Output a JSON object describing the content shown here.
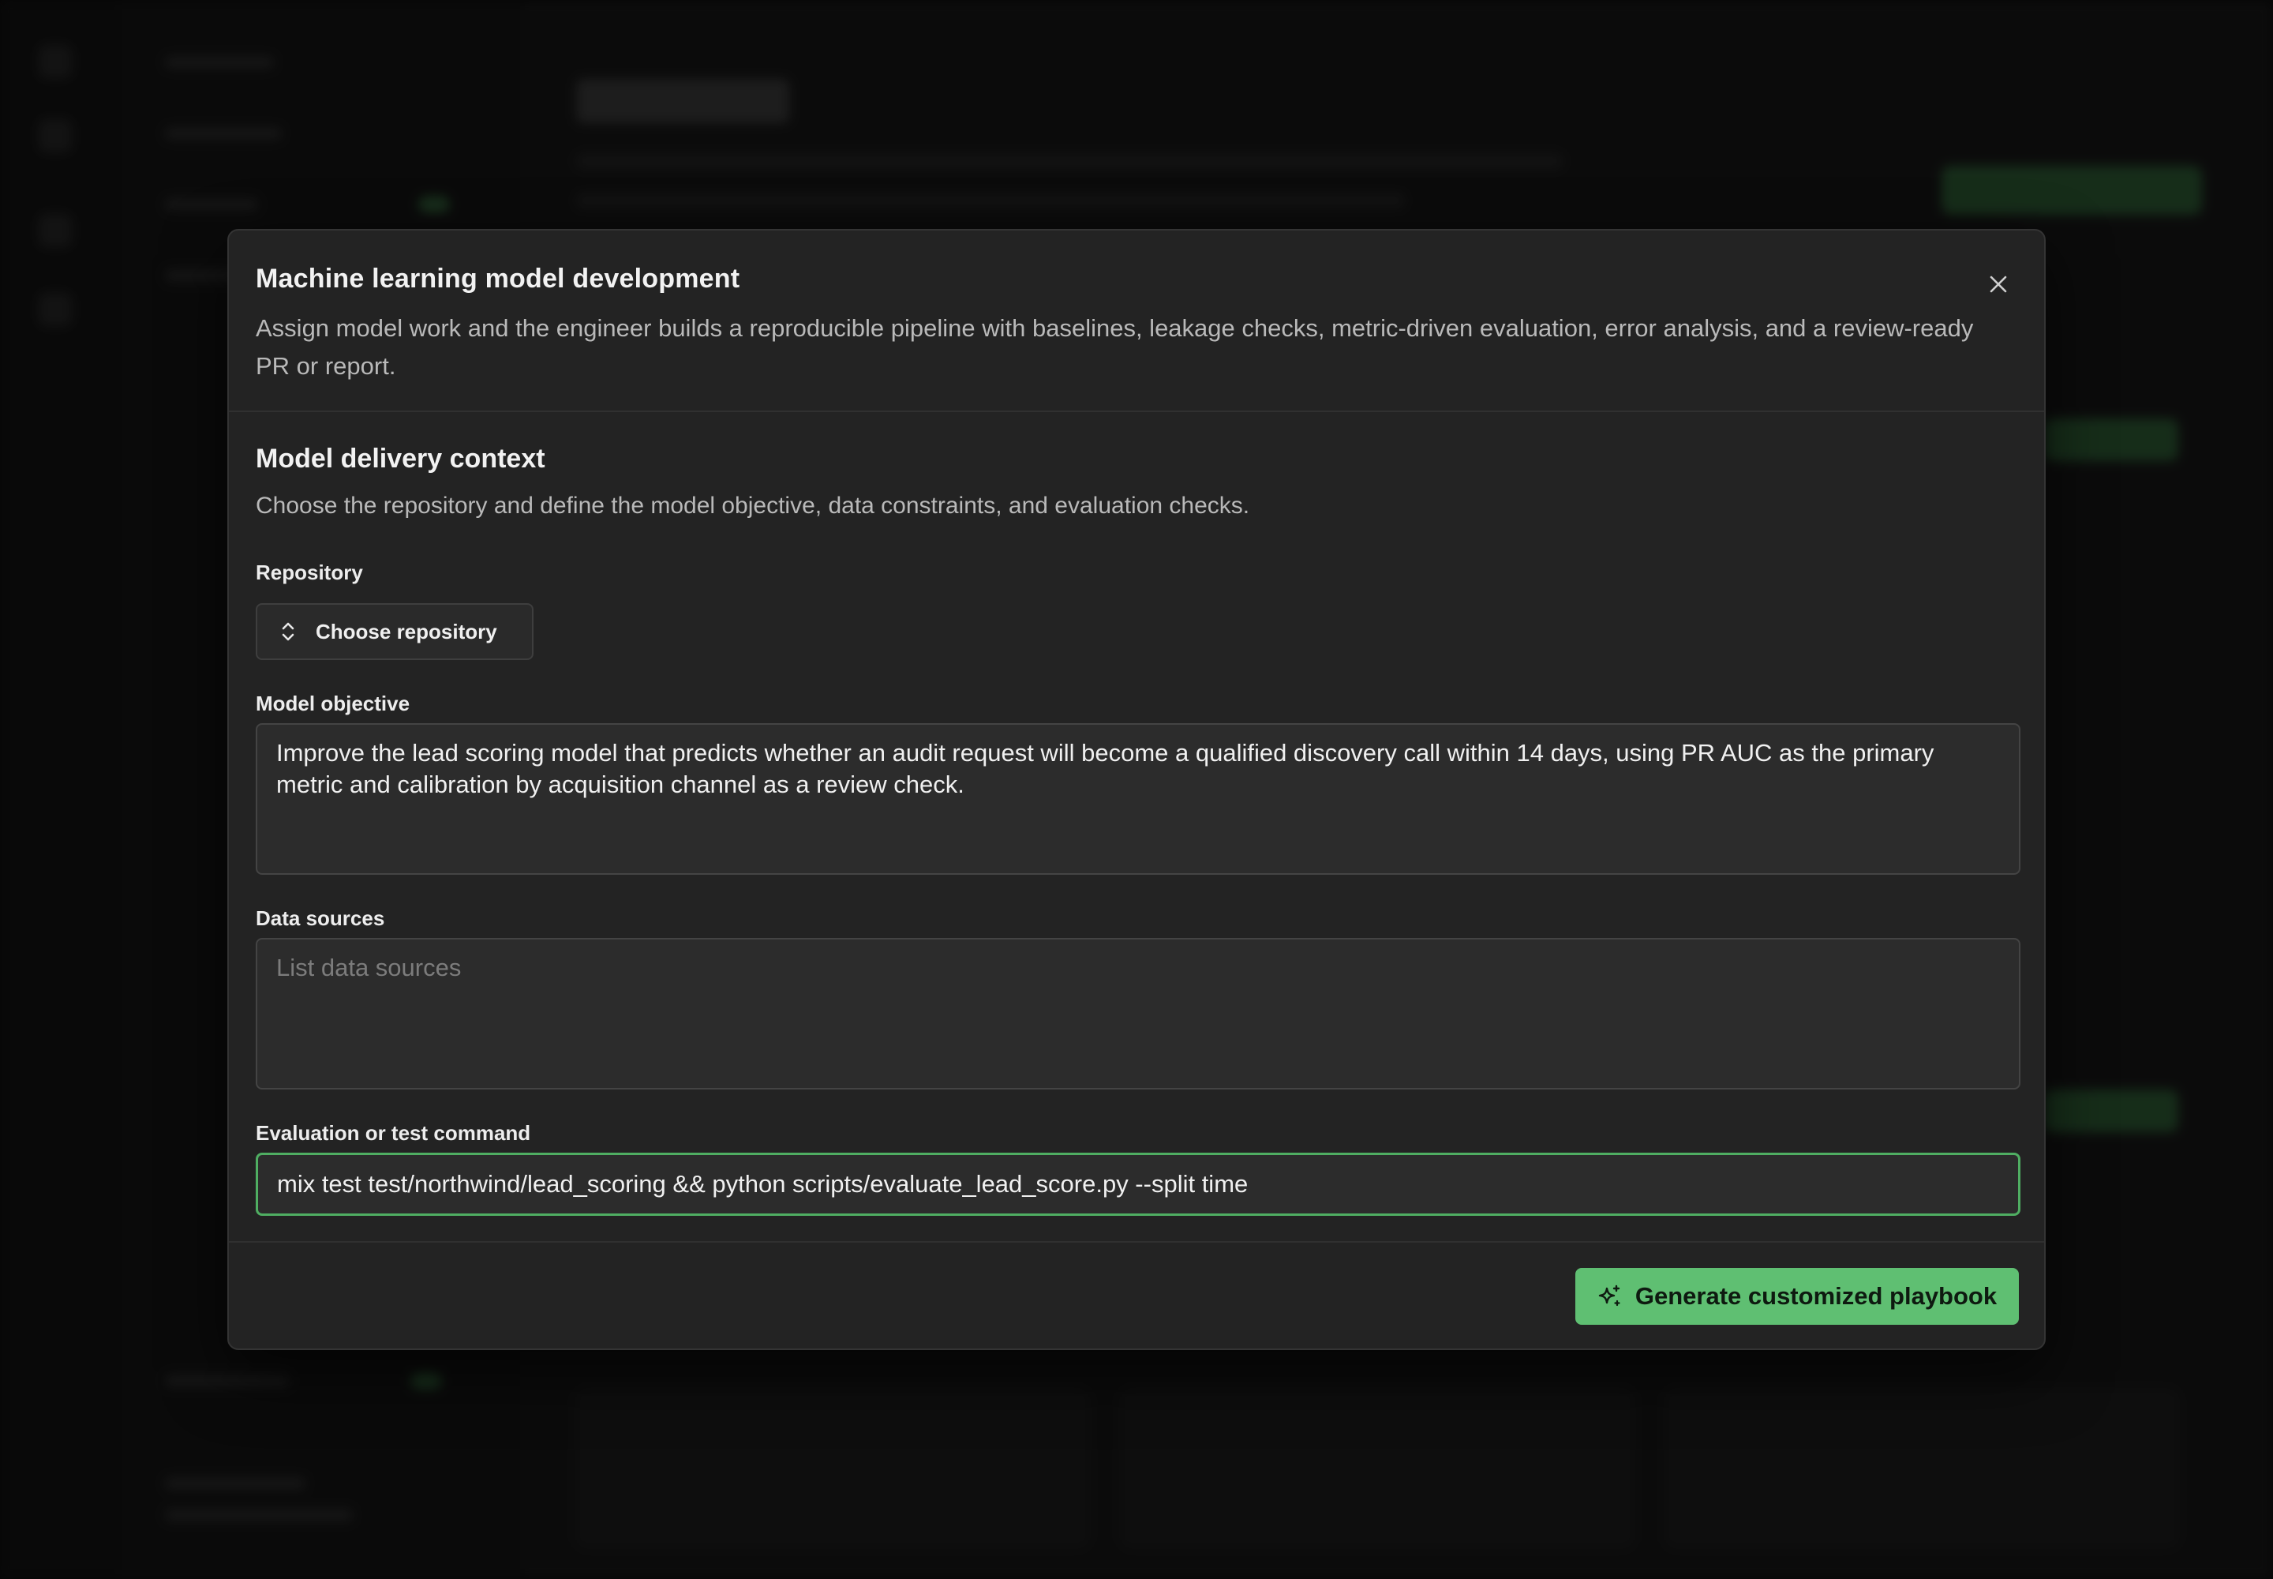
{
  "modal": {
    "title": "Machine learning model development",
    "description": "Assign model work and the engineer builds a reproducible pipeline with baselines, leakage checks, metric-driven evaluation, error analysis, and a review-ready PR or report.",
    "close_icon": "close-icon"
  },
  "section": {
    "title": "Model delivery context",
    "description": "Choose the repository and define the model objective, data constraints, and evaluation checks."
  },
  "repository": {
    "label": "Repository",
    "button_label": "Choose repository",
    "icon": "chevron-up-down-icon"
  },
  "objective": {
    "label": "Model objective",
    "value": "Improve the lead scoring model that predicts whether an audit request will become a qualified discovery call within 14 days, using PR AUC as the primary metric and calibration by acquisition channel as a review check."
  },
  "data_sources": {
    "label": "Data sources",
    "value": "",
    "placeholder": "List data sources"
  },
  "evaluation": {
    "label": "Evaluation or test command",
    "value": "mix test test/northwind/lead_scoring && python scripts/evaluate_lead_score.py --split time"
  },
  "generate": {
    "label": "Generate customized playbook",
    "icon": "sparkle-icon"
  },
  "colors": {
    "accent": "#5fbf72",
    "focus_border": "#4fae62",
    "modal_bg": "#232323"
  }
}
